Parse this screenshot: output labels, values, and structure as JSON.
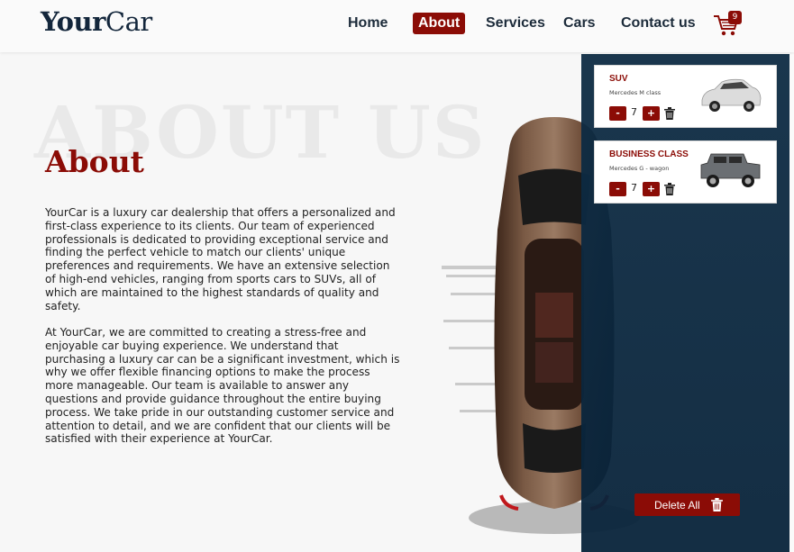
{
  "brand": {
    "bold": "Your",
    "light": "Car"
  },
  "nav": [
    {
      "label": "Home"
    },
    {
      "label": "About",
      "active": true
    },
    {
      "label": "Services"
    },
    {
      "label": "Cars"
    },
    {
      "label": "Contact us"
    }
  ],
  "cart": {
    "count": "9",
    "icon": "cart-icon"
  },
  "about": {
    "background_text": "ABOUT US",
    "title": "About",
    "paragraph1": "YourCar is a luxury car dealership that offers a personalized and first-class experience to its clients. Our team of experienced professionals is dedicated to providing exceptional service and finding the perfect vehicle to match our clients' unique preferences and requirements. We have an extensive selection of high-end vehicles, ranging from sports cars to SUVs, all of which are maintained to the highest standards of quality and safety.",
    "paragraph2": "At YourCar, we are committed to creating a stress-free and enjoyable car buying experience. We understand that purchasing a luxury car can be a significant investment, which is why we offer flexible financing options to make the process more manageable. Our team is available to answer any questions and provide guidance throughout the entire buying process. We take pride in our outstanding customer service and attention to detail, and we are confident that our clients will be satisfied with their experience at YourCar."
  },
  "cart_panel": {
    "items": [
      {
        "category": "SUV",
        "model": "Mercedes M class",
        "quantity": "7",
        "minus": "-",
        "plus": "+"
      },
      {
        "category": "BUSINESS CLASS",
        "model": "Mercedes G - wagon",
        "quantity": "7",
        "minus": "-",
        "plus": "+"
      }
    ],
    "delete_all_label": "Delete All"
  },
  "colors": {
    "accent": "#8b0c06",
    "navy": "#13263b",
    "panel": "#0e2c44"
  }
}
